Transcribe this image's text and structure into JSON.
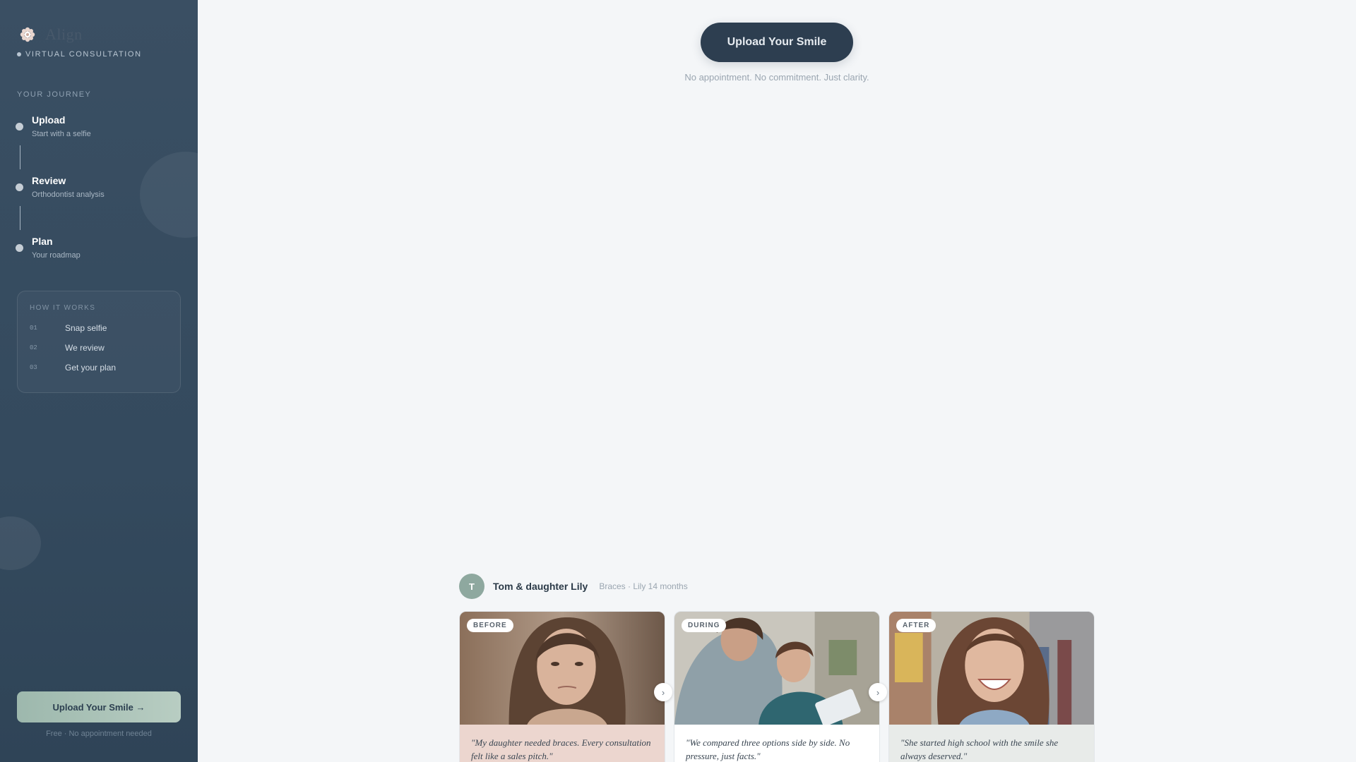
{
  "sidebar": {
    "brand_name": "Align",
    "consult_label": "VIRTUAL CONSULTATION",
    "journey_label": "YOUR JOURNEY",
    "steps": [
      {
        "title": "Upload",
        "subtitle": "Start with a selfie"
      },
      {
        "title": "Review",
        "subtitle": "Orthodontist analysis"
      },
      {
        "title": "Plan",
        "subtitle": "Your roadmap"
      }
    ],
    "how_title": "HOW IT WORKS",
    "how_items": [
      {
        "num": "01",
        "text": "Snap selfie"
      },
      {
        "num": "02",
        "text": "We review"
      },
      {
        "num": "03",
        "text": "Get your plan"
      }
    ],
    "cta_label": "Upload Your Smile →",
    "cta_note": "Free · No appointment needed"
  },
  "main": {
    "cta_label": "Upload Your Smile",
    "cta_note": "No appointment. No commitment. Just clarity."
  },
  "testimonial": {
    "avatar_initial": "T",
    "name": "Tom & daughter Lily",
    "meta": "Braces · Lily 14 months",
    "cards": [
      {
        "label": "BEFORE",
        "quote": "\"My daughter needed braces. Every consultation felt like a sales pitch.\"",
        "quote_bg": "#ecd6cf"
      },
      {
        "label": "DURING",
        "quote": "\"We compared three options side by side. No pressure, just facts.\"",
        "quote_bg": "#ffffff"
      },
      {
        "label": "AFTER",
        "quote": "\"She started high school with the smile she always deserved.\"",
        "quote_bg": "#e8ebe9"
      }
    ]
  },
  "colors": {
    "sidebar_bg": "#3a4f63",
    "primary": "#2d3e50",
    "accent": "#9db8ad"
  },
  "icons": {
    "brand": "flower-logo-icon",
    "arrow": "chevron-right-icon"
  }
}
